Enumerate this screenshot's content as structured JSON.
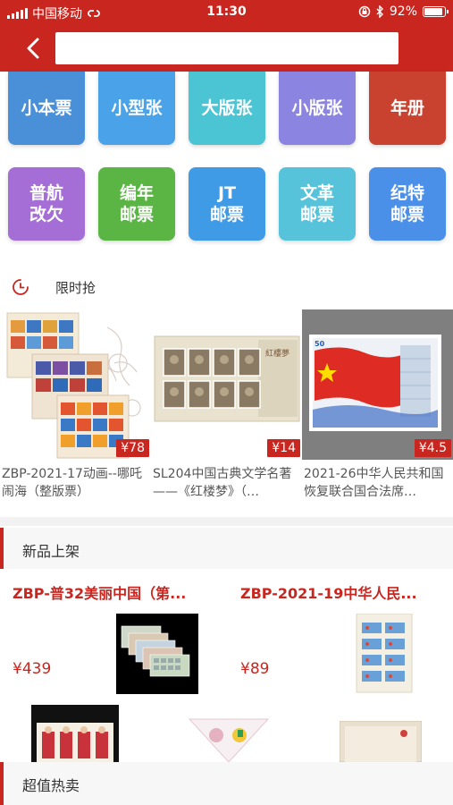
{
  "status_bar": {
    "carrier": "中国移动",
    "time": "11:30",
    "battery": "92%",
    "battery_level": 0.92
  },
  "nav": {
    "back_icon": "chevron-left-icon",
    "search_value": "",
    "search_placeholder": ""
  },
  "categories": [
    {
      "label": "小本票",
      "color": "#4a90d9"
    },
    {
      "label": "小型张",
      "color": "#4aa3e8"
    },
    {
      "label": "大版张",
      "color": "#4bc4d4"
    },
    {
      "label": "小版张",
      "color": "#8b84e0"
    },
    {
      "label": "年册",
      "color": "#c9412f"
    },
    {
      "label": "普航\n改欠",
      "color": "#a56ed6"
    },
    {
      "label": "编年\n邮票",
      "color": "#5bb544"
    },
    {
      "label": "JT\n邮票",
      "color": "#3f9be6"
    },
    {
      "label": "文革\n邮票",
      "color": "#57c3db"
    },
    {
      "label": "纪特\n邮票",
      "color": "#4a8fe8"
    }
  ],
  "flash_sale": {
    "title": "限时抢",
    "icon": "clock-icon",
    "items": [
      {
        "name": "ZBP-2021-17动画--哪吒闹海（整版票）",
        "price": "¥78"
      },
      {
        "name": "SL204中国古典文学名著——《红楼梦》（…",
        "price": "¥14"
      },
      {
        "name": "2021-26中华人民共和国恢复联合国合法席…",
        "price": "¥4.5"
      }
    ]
  },
  "new_arrivals": {
    "title": "新品上架",
    "items": [
      {
        "name": "ZBP-普32美丽中国（第...",
        "price": "¥439"
      },
      {
        "name": "ZBP-2021-19中华人民...",
        "price": "¥89"
      }
    ]
  },
  "hot_sale": {
    "title": "超值热卖"
  },
  "colors": {
    "brand_red": "#c9261f",
    "price_red": "#c9261f"
  }
}
